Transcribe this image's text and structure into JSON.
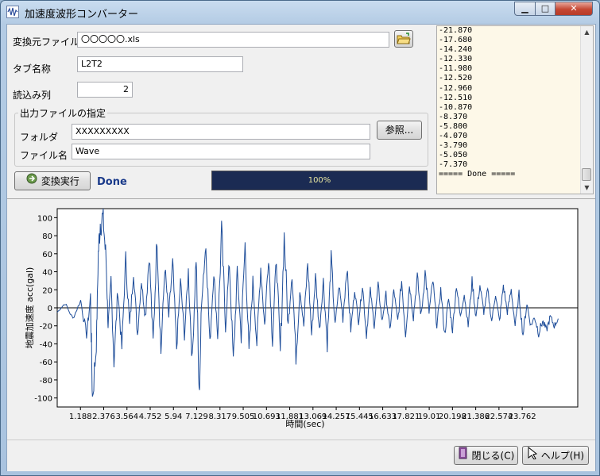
{
  "window": {
    "title": "加速度波形コンバーター",
    "min_glyph": "▁",
    "max_glyph": "□",
    "close_glyph": "✕"
  },
  "form": {
    "source_file_label": "変換元ファイル",
    "source_file_value": "〇〇〇〇〇.xls",
    "tab_name_label": "タブ名称",
    "tab_name_value": "L2T2",
    "read_column_label": "読込み列",
    "read_column_value": "2",
    "output_group_title": "出力ファイルの指定",
    "folder_label": "フォルダ",
    "folder_value": "XXXXXXXXX",
    "browse_button": "参照...",
    "filename_label": "ファイル名",
    "filename_value": "Wave"
  },
  "actions": {
    "convert_button": "変換実行",
    "status_text": "Done",
    "progress_text": "100%",
    "progress_fraction": 1.0
  },
  "log": {
    "lines": [
      "-21.870",
      "-17.680",
      "-14.240",
      "-12.330",
      "-11.980",
      "-12.520",
      "-12.960",
      "-12.510",
      "-10.870",
      "-8.370",
      "-5.800",
      "-4.070",
      "-3.790",
      "-5.050",
      "-7.370",
      "===== Done ====="
    ]
  },
  "footer": {
    "close_button": "閉じる(C)",
    "help_button": "ヘルプ(H)"
  },
  "colors": {
    "series": "#1f4e9a",
    "progress_bg": "#1b2b53",
    "status_text": "#1a3a8a"
  },
  "chart_data": {
    "type": "line",
    "xlabel": "時間(sec)",
    "ylabel": "地震加速度 acc(gal)",
    "ylim": [
      -110,
      110
    ],
    "yticks": [
      100,
      80,
      60,
      40,
      20,
      0,
      -20,
      -40,
      -60,
      -80,
      -100
    ],
    "xlim": [
      0,
      26.6
    ],
    "xtick_labels": [
      "1.188",
      "2.376",
      "3.564",
      "4.752",
      "5.94",
      "7.129",
      "8.317",
      "9.505",
      "10.693",
      "11.881",
      "13.069",
      "14.257",
      "15.445",
      "16.633",
      "17.821",
      "19.01",
      "20.198",
      "21.386",
      "22.574",
      "23.762"
    ],
    "series": [
      {
        "values_env": [
          [
            0.0,
            -5
          ],
          [
            0.4,
            5
          ],
          [
            0.8,
            -12
          ],
          [
            1.2,
            8
          ],
          [
            1.5,
            -30
          ],
          [
            1.7,
            10
          ],
          [
            1.8,
            -100
          ],
          [
            2.0,
            -40
          ],
          [
            2.1,
            60
          ],
          [
            2.2,
            95
          ],
          [
            2.35,
            100
          ],
          [
            2.5,
            50
          ],
          [
            2.6,
            -20
          ],
          [
            2.75,
            30
          ],
          [
            2.9,
            -60
          ],
          [
            3.1,
            20
          ],
          [
            3.3,
            -45
          ],
          [
            3.5,
            55
          ],
          [
            3.7,
            -20
          ],
          [
            3.9,
            40
          ],
          [
            4.1,
            -30
          ],
          [
            4.3,
            30
          ],
          [
            4.5,
            -10
          ],
          [
            4.7,
            60
          ],
          [
            4.9,
            -40
          ],
          [
            5.1,
            80
          ],
          [
            5.3,
            -50
          ],
          [
            5.5,
            45
          ],
          [
            5.7,
            -10
          ],
          [
            5.9,
            50
          ],
          [
            6.1,
            -45
          ],
          [
            6.3,
            30
          ],
          [
            6.5,
            -30
          ],
          [
            6.7,
            40
          ],
          [
            6.9,
            -60
          ],
          [
            7.1,
            60
          ],
          [
            7.25,
            -100
          ],
          [
            7.4,
            20
          ],
          [
            7.6,
            70
          ],
          [
            7.8,
            -40
          ],
          [
            8.0,
            40
          ],
          [
            8.2,
            -30
          ],
          [
            8.4,
            85
          ],
          [
            8.6,
            -20
          ],
          [
            8.8,
            50
          ],
          [
            9.0,
            -60
          ],
          [
            9.2,
            40
          ],
          [
            9.4,
            -30
          ],
          [
            9.6,
            70
          ],
          [
            9.8,
            -50
          ],
          [
            10.0,
            30
          ],
          [
            10.2,
            -40
          ],
          [
            10.4,
            45
          ],
          [
            10.6,
            -20
          ],
          [
            10.8,
            60
          ],
          [
            11.0,
            -35
          ],
          [
            11.2,
            55
          ],
          [
            11.4,
            -50
          ],
          [
            11.6,
            80
          ],
          [
            11.8,
            -20
          ],
          [
            12.0,
            40
          ],
          [
            12.2,
            -55
          ],
          [
            12.4,
            20
          ],
          [
            12.6,
            -20
          ],
          [
            12.8,
            50
          ],
          [
            13.0,
            -30
          ],
          [
            13.2,
            35
          ],
          [
            13.4,
            -25
          ],
          [
            13.6,
            30
          ],
          [
            13.8,
            -40
          ],
          [
            14.0,
            55
          ],
          [
            14.2,
            -20
          ],
          [
            14.4,
            25
          ],
          [
            14.6,
            -10
          ],
          [
            14.8,
            45
          ],
          [
            15.0,
            -25
          ],
          [
            15.2,
            20
          ],
          [
            15.4,
            -15
          ],
          [
            15.6,
            25
          ],
          [
            15.8,
            -30
          ],
          [
            16.0,
            20
          ],
          [
            16.2,
            -20
          ],
          [
            16.4,
            25
          ],
          [
            16.6,
            -15
          ],
          [
            16.8,
            15
          ],
          [
            17.0,
            -25
          ],
          [
            17.2,
            20
          ],
          [
            17.4,
            -15
          ],
          [
            17.6,
            30
          ],
          [
            17.8,
            -30
          ],
          [
            18.0,
            25
          ],
          [
            18.2,
            -10
          ],
          [
            18.4,
            35
          ],
          [
            18.6,
            -10
          ],
          [
            18.8,
            40
          ],
          [
            19.0,
            -5
          ],
          [
            19.2,
            30
          ],
          [
            19.4,
            -20
          ],
          [
            19.6,
            20
          ],
          [
            19.8,
            -30
          ],
          [
            20.0,
            10
          ],
          [
            20.2,
            -25
          ],
          [
            20.4,
            25
          ],
          [
            20.6,
            -10
          ],
          [
            20.8,
            15
          ],
          [
            21.0,
            -20
          ],
          [
            21.2,
            30
          ],
          [
            21.4,
            -10
          ],
          [
            21.6,
            25
          ],
          [
            21.8,
            -5
          ],
          [
            22.0,
            20
          ],
          [
            22.2,
            -15
          ],
          [
            22.4,
            15
          ],
          [
            22.6,
            -15
          ],
          [
            22.8,
            25
          ],
          [
            23.0,
            -5
          ],
          [
            23.2,
            20
          ],
          [
            23.4,
            -20
          ],
          [
            23.6,
            15
          ],
          [
            23.8,
            -30
          ],
          [
            24.0,
            5
          ],
          [
            24.2,
            -20
          ],
          [
            24.4,
            -10
          ],
          [
            24.6,
            -28
          ],
          [
            24.8,
            -15
          ],
          [
            25.0,
            -25
          ],
          [
            25.2,
            -10
          ],
          [
            25.4,
            -20
          ],
          [
            25.6,
            -12
          ]
        ]
      }
    ]
  }
}
